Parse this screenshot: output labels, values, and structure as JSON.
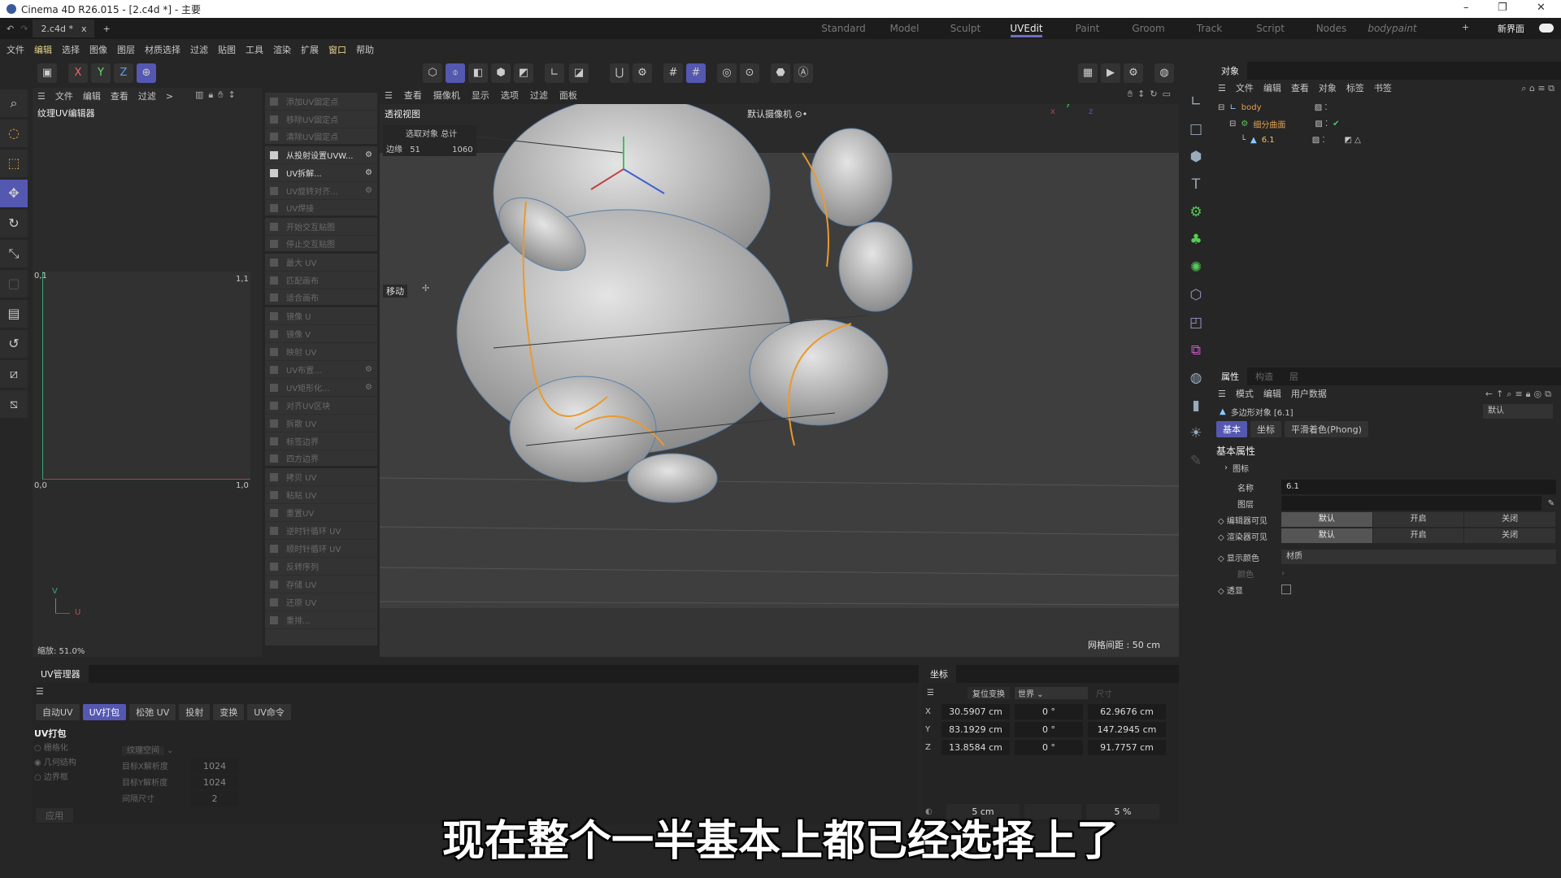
{
  "window": {
    "title": "Cinema 4D R26.015 - [2.c4d *] - 主要",
    "minimize": "–",
    "restore": "❐",
    "close": "✕"
  },
  "doc_tab": {
    "label": "2.c4d *",
    "close": "x",
    "add": "+"
  },
  "layouts": [
    "Standard",
    "Model",
    "Sculpt",
    "UVEdit",
    "Paint",
    "Groom",
    "Track",
    "Script",
    "Nodes",
    "bodypaint"
  ],
  "layout_active": "UVEdit",
  "layout_add": "+",
  "new_ui": "新界面",
  "menu": [
    "文件",
    "编辑",
    "选择",
    "图像",
    "图层",
    "材质选择",
    "过滤",
    "贴图",
    "工具",
    "渲染",
    "扩展",
    "窗口",
    "帮助"
  ],
  "axis_buttons": [
    "X",
    "Y",
    "Z"
  ],
  "uv_editor": {
    "menu": [
      "文件",
      "编辑",
      "查看",
      "过滤",
      ">"
    ],
    "title": "纹理UV编辑器",
    "corner_tl": "0,1",
    "corner_tr": "1,1",
    "corner_bl": "0,0",
    "corner_br": "1,0",
    "axis_v": "V",
    "axis_u": "U",
    "zoom": "缩放: 51.0%"
  },
  "uv_commands": [
    {
      "label": "添加UV固定点",
      "enabled": false
    },
    {
      "label": "移除UV固定点",
      "enabled": false
    },
    {
      "label": "清除UV固定点",
      "enabled": false,
      "sep": true
    },
    {
      "label": "从投射设置UVW...",
      "enabled": true,
      "gear": true
    },
    {
      "label": "UV拆解...",
      "enabled": true,
      "gear": true
    },
    {
      "label": "UV旋转对齐...",
      "enabled": false,
      "gear": true
    },
    {
      "label": "UV焊接",
      "enabled": false,
      "sep": true
    },
    {
      "label": "开始交互贴图",
      "enabled": false
    },
    {
      "label": "停止交互贴图",
      "enabled": false,
      "sep": true
    },
    {
      "label": "最大 UV",
      "enabled": false
    },
    {
      "label": "匹配画布",
      "enabled": false
    },
    {
      "label": "适合画布",
      "enabled": false,
      "sep": true
    },
    {
      "label": "镜像 U",
      "enabled": false
    },
    {
      "label": "镜像 V",
      "enabled": false
    },
    {
      "label": "映射 UV",
      "enabled": false
    },
    {
      "label": "UV布置...",
      "enabled": false,
      "gear": true
    },
    {
      "label": "UV矩形化...",
      "enabled": false,
      "gear": true
    },
    {
      "label": "对齐UV区块",
      "enabled": false
    },
    {
      "label": "拆散 UV",
      "enabled": false
    },
    {
      "label": "标签边界",
      "enabled": false
    },
    {
      "label": "四方边界",
      "enabled": false,
      "sep": true
    },
    {
      "label": "拷贝 UV",
      "enabled": false
    },
    {
      "label": "粘贴 UV",
      "enabled": false
    },
    {
      "label": "重置UV",
      "enabled": false
    },
    {
      "label": "逆时针循环 UV",
      "enabled": false
    },
    {
      "label": "顺时针循环 UV",
      "enabled": false
    },
    {
      "label": "反转序列",
      "enabled": false
    },
    {
      "label": "存储 UV",
      "enabled": false
    },
    {
      "label": "还原 UV",
      "enabled": false
    },
    {
      "label": "重排...",
      "enabled": false
    }
  ],
  "viewport": {
    "menu": [
      "查看",
      "摄像机",
      "显示",
      "选项",
      "过滤",
      "面板"
    ],
    "title": "透视视图",
    "camera": "默认摄像机 ⊙•",
    "stats_header_sel": "选取对象",
    "stats_header_total": "总计",
    "stats_label": "边缘",
    "stats_selected": "51",
    "stats_total": "1060",
    "tool": "移动",
    "grid": "网格间距 : 50 cm"
  },
  "object_manager": {
    "tab": "对象",
    "menu": [
      "文件",
      "编辑",
      "查看",
      "对象",
      "标签",
      "书签"
    ],
    "objects": [
      {
        "name": "body",
        "color": "#e0a050"
      },
      {
        "name": "细分曲面",
        "color": "#e0a050",
        "check": "✔"
      },
      {
        "name": "6.1",
        "color": "#f0c060"
      }
    ]
  },
  "attributes": {
    "tabs": [
      "属性",
      "构造",
      "层"
    ],
    "menu": [
      "模式",
      "编辑",
      "用户数据"
    ],
    "object": "多边形对象 [6.1]",
    "mode": "默认",
    "subtabs": [
      "基本",
      "坐标",
      "平滑着色(Phong)"
    ],
    "section": "基本属性",
    "icon_row": "图标",
    "name_label": "名称",
    "name_value": "6.1",
    "layer_label": "图层",
    "editor_vis": "编辑器可见",
    "render_vis": "渲染器可见",
    "vis_options": [
      "默认",
      "开启",
      "关闭"
    ],
    "display_color": "显示颜色",
    "display_color_value": "材质",
    "color_label": "颜色",
    "xray": "透显"
  },
  "uv_manager": {
    "tab": "UV管理器",
    "buttons": [
      "自动UV",
      "UV打包",
      "松弛 UV",
      "投射",
      "变换",
      "UV命令"
    ],
    "active": "UV打包",
    "section": "UV打包",
    "radios": [
      "栅格化",
      "几何结构",
      "边界框"
    ],
    "radio_selected": "几何结构",
    "space": "纹理空间",
    "res_x_label": "目标X解析度",
    "res_x": "1024",
    "res_y_label": "目标Y解析度",
    "res_y": "1024",
    "spacing_label": "间隔尺寸",
    "spacing": "2",
    "apply": "应用"
  },
  "coordinates": {
    "tab": "坐标",
    "reset": "复位变换",
    "space": "世界",
    "size_mode": "尺寸",
    "rows": [
      {
        "axis": "X",
        "pos": "30.5907 cm",
        "rot": "0 °",
        "size": "62.9676 cm"
      },
      {
        "axis": "Y",
        "pos": "83.1929 cm",
        "rot": "0 °",
        "size": "147.2945 cm"
      },
      {
        "axis": "Z",
        "pos": "13.8584 cm",
        "rot": "0 °",
        "size": "91.7757 cm"
      }
    ],
    "snap_p": "5 cm",
    "snap_s": "5 %"
  },
  "subtitle": "现在整个一半基本上都已经选择上了",
  "colors": {
    "accent": "#5558b0",
    "selection_edges": "#e89a30",
    "axis_x": "#c04040",
    "axis_y": "#40c060",
    "axis_z": "#4060d0"
  }
}
